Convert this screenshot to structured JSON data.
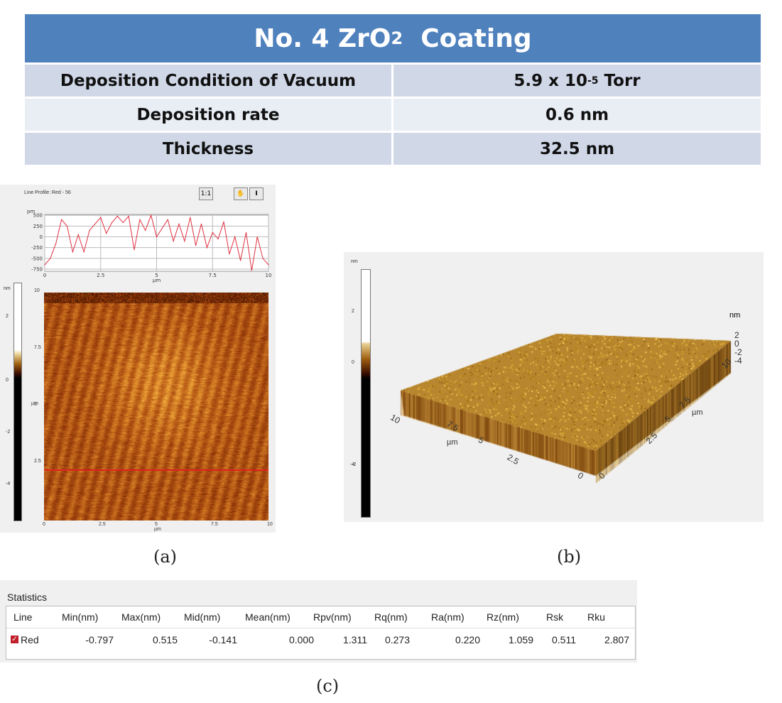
{
  "table": {
    "title_main": "No. 4 ZrO",
    "title_sub": "2",
    "title_tail": "  Coating",
    "rows": [
      {
        "label": "Deposition Condition of Vacuum",
        "value_main": "5.9 x 10",
        "value_sup": "-5",
        "value_tail": " Torr"
      },
      {
        "label": "Deposition rate",
        "value": "0.6 nm"
      },
      {
        "label": "Thickness",
        "value": "32.5 nm"
      }
    ]
  },
  "panel_a": {
    "profile_title": "Line Profile: Red  -  56",
    "icons": [
      "one-to-one-icon",
      "hand-pan-icon",
      "cursor-i-beam-icon"
    ],
    "caption": "(a)",
    "colorbar_unit": "nm",
    "colorbar_ticks": [
      "2",
      "0",
      "-2",
      "-4"
    ],
    "image_x_ticks": [
      "0",
      "2.5",
      "5",
      "7.5",
      "10"
    ],
    "image_y_ticks": [
      "10",
      "7.5",
      "5",
      "2.5"
    ],
    "image_x_label": "µm",
    "image_y_label": "µm"
  },
  "chart_data": {
    "type": "line",
    "title": "Line Profile: Red  -  56",
    "xlabel": "µm",
    "ylabel": "pm",
    "xlim": [
      0,
      10
    ],
    "ylim": [
      -800,
      520
    ],
    "x_ticks": [
      "0",
      "2.5",
      "5",
      "7.5",
      "10"
    ],
    "y_ticks": [
      "500",
      "250",
      "0",
      "-250",
      "-500",
      "-750"
    ],
    "grid": true,
    "color": "#e03040",
    "x": [
      0,
      0.25,
      0.5,
      0.75,
      1,
      1.25,
      1.5,
      1.75,
      2,
      2.25,
      2.5,
      2.75,
      3,
      3.25,
      3.5,
      3.75,
      4,
      4.25,
      4.5,
      4.75,
      5,
      5.25,
      5.5,
      5.75,
      6,
      6.25,
      6.5,
      6.75,
      7,
      7.25,
      7.5,
      7.75,
      8,
      8.25,
      8.5,
      8.75,
      9,
      9.25,
      9.5,
      9.75,
      10
    ],
    "y": [
      -650,
      -500,
      -150,
      400,
      250,
      -350,
      50,
      -350,
      150,
      300,
      450,
      80,
      330,
      480,
      330,
      480,
      -300,
      400,
      150,
      500,
      0,
      200,
      400,
      -100,
      300,
      -100,
      450,
      -200,
      300,
      -250,
      100,
      -50,
      350,
      -400,
      0,
      -550,
      100,
      -780,
      0,
      -500,
      -650
    ]
  },
  "panel_b": {
    "caption": "(b)",
    "colorbar_unit": "nm",
    "colorbar_ticks": [
      "2",
      "0",
      "-2",
      "-4"
    ],
    "z_unit": "nm",
    "z_ticks": [
      "2",
      "0",
      "-2",
      "-4"
    ],
    "x_ticks": [
      "0",
      "2.5",
      "5",
      "7.5",
      "10"
    ],
    "y_ticks": [
      "0",
      "2.5",
      "5",
      "7.5",
      "10"
    ],
    "axis_label": "µm"
  },
  "statistics": {
    "title": "Statistics",
    "caption": "(c)",
    "headers": [
      "Line",
      "Min(nm)",
      "Max(nm)",
      "Mid(nm)",
      "Mean(nm)",
      "Rpv(nm)",
      "Rq(nm)",
      "Ra(nm)",
      "Rz(nm)",
      "Rsk",
      "Rku"
    ],
    "row": {
      "checked": true,
      "values": [
        "Red",
        "-0.797",
        "0.515",
        "-0.141",
        "0.000",
        "1.311",
        "0.273",
        "0.220",
        "1.059",
        "0.511",
        "2.807"
      ]
    }
  }
}
